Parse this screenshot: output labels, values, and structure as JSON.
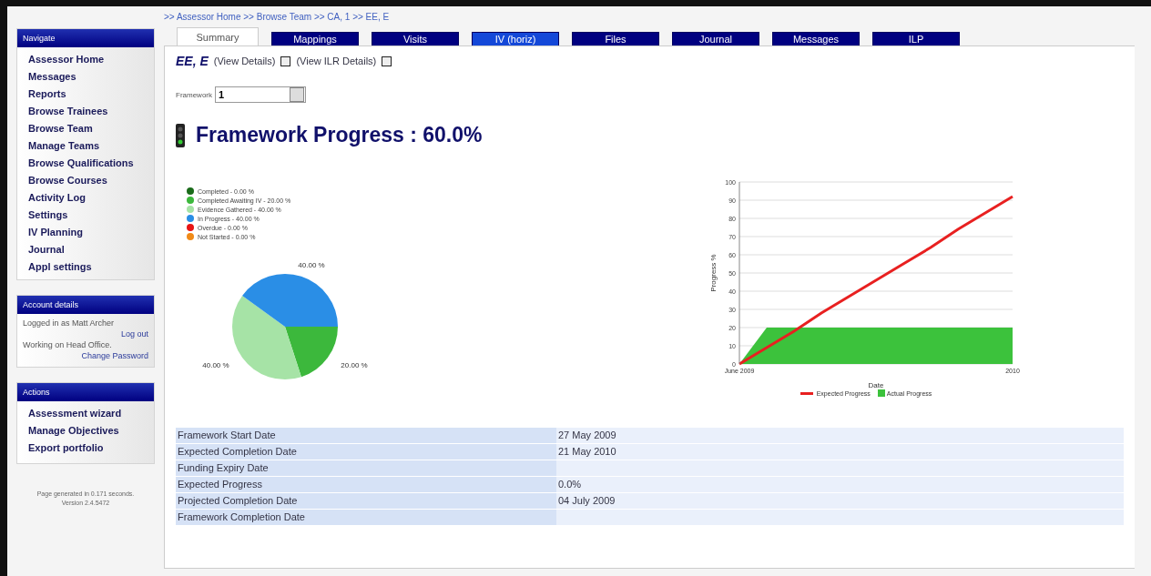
{
  "sidebar": {
    "navigate": {
      "title": "Navigate",
      "items": [
        "Assessor Home",
        "Messages",
        "Reports",
        "Browse Trainees",
        "Browse Team",
        "Manage Teams",
        "Browse Qualifications",
        "Browse Courses",
        "Activity Log",
        "Settings",
        "IV Planning",
        "Journal",
        "Appl settings"
      ]
    },
    "account": {
      "title": "Account details",
      "logged_in": "Logged in as Matt Archer",
      "logout": "Log out",
      "working_on": "Working on Head Office.",
      "change_password": "Change Password"
    },
    "actions": {
      "title": "Actions",
      "items": [
        "Assessment wizard",
        "Manage Objectives",
        "Export portfolio"
      ]
    },
    "footer": [
      "Page generated in 0.171 seconds.",
      "Version 2.4.5472"
    ]
  },
  "breadcrumb": ">> Assessor Home >> Browse Team >> CA, 1 >> EE, E",
  "tabs": [
    {
      "label": "Summary",
      "selected": true,
      "color": "#ffffff"
    },
    {
      "label": "Mappings",
      "selected": false,
      "color": "#000080"
    },
    {
      "label": "Visits",
      "selected": false,
      "color": "#000080"
    },
    {
      "label": "IV (horiz)",
      "selected": false,
      "color": "#1448d8"
    },
    {
      "label": "Files",
      "selected": false,
      "color": "#000080"
    },
    {
      "label": "Journal",
      "selected": false,
      "color": "#000080"
    },
    {
      "label": "Messages",
      "selected": false,
      "color": "#000080"
    },
    {
      "label": "ILP",
      "selected": false,
      "color": "#000080"
    }
  ],
  "learner": {
    "name": "EE, E",
    "links": [
      "(View Details)",
      "(View ILR Details)"
    ]
  },
  "framework_select": {
    "label": "Framework",
    "value": "1"
  },
  "progress_title": "Framework Progress : 60.0%",
  "pie": {
    "chart_data": {
      "type": "pie",
      "legend": "upper left",
      "categories": [
        "Completed - 0.00 %",
        "Completed Awaiting IV - 20.00 %",
        "Evidence Gathered - 40.00 %",
        "In Progress - 40.00 %",
        "Overdue - 0.00 %",
        "Not Started - 0.00 %"
      ],
      "values": [
        0,
        20,
        40,
        40,
        0,
        0
      ],
      "colors": [
        "#1a6b1a",
        "#3cb83c",
        "#a6e3a6",
        "#2a8ee6",
        "#e81414",
        "#f08a18"
      ],
      "value_labels": [
        null,
        "20.00 %",
        "40.00 %",
        "40.00 %",
        null,
        null
      ]
    }
  },
  "progress_chart": {
    "chart_data": {
      "type": "line",
      "grid": true,
      "legend": "lower center",
      "xlabel": "Date",
      "ylabel": "Progress %",
      "categories": [
        "June 2009",
        null,
        null,
        null,
        null,
        null,
        null,
        null,
        null,
        null,
        "2010"
      ],
      "series": [
        {
          "name": "Expected Progress",
          "type": "line",
          "color": "#e82020",
          "values": [
            0,
            9,
            18,
            28,
            37,
            46,
            55,
            64,
            74,
            83,
            92
          ]
        },
        {
          "name": "Actual Progress",
          "type": "area",
          "color": "#3cc23c",
          "values": [
            0,
            20,
            20,
            20,
            20,
            20,
            20,
            20,
            20,
            20,
            20
          ]
        }
      ],
      "ylim": [
        0,
        100
      ],
      "yticks": [
        0,
        10,
        20,
        30,
        40,
        50,
        60,
        70,
        80,
        90,
        100
      ]
    }
  },
  "details": [
    {
      "label": "Framework Start Date",
      "value": "27 May 2009"
    },
    {
      "label": "Expected Completion Date",
      "value": "21 May 2010"
    },
    {
      "label": "Funding Expiry Date"
    },
    {
      "label": "Expected Progress",
      "value": "0.0%"
    },
    {
      "label": "Projected Completion Date",
      "value": "04 July 2009"
    },
    {
      "label": "Framework Completion Date"
    }
  ]
}
